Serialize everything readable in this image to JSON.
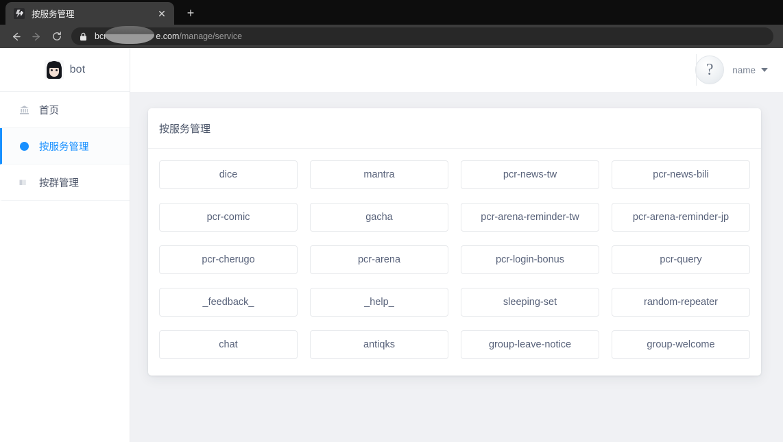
{
  "browser": {
    "tab": {
      "title": "按服务管理",
      "favicon_name": "bot-lightning-favicon",
      "close_label": "✕"
    },
    "new_tab_label": "+",
    "nav": {
      "back_label": "Back",
      "forward_label": "Forward",
      "reload_label": "Reload"
    },
    "omnibox": {
      "lock_label": "Secure",
      "url_prefix": "bcr",
      "url_host_suffix": "e.com",
      "url_path": "/manage/service",
      "redacted": true
    }
  },
  "sidebar": {
    "brand": {
      "name": "bot",
      "avatar_name": "bot-avatar"
    },
    "items": [
      {
        "label": "首页",
        "icon": "bank-icon",
        "active": false
      },
      {
        "label": "按服务管理",
        "icon": "dot-icon",
        "active": true
      },
      {
        "label": "按群管理",
        "icon": "bar-chart-icon",
        "active": false
      }
    ]
  },
  "topbar": {
    "user_name": "name",
    "avatar_glyph": "?",
    "avatar_name": "user-avatar-placeholder",
    "caret_name": "chevron-down-icon"
  },
  "main": {
    "card_title": "按服务管理",
    "services": [
      "dice",
      "mantra",
      "pcr-news-tw",
      "pcr-news-bili",
      "pcr-comic",
      "gacha",
      "pcr-arena-reminder-tw",
      "pcr-arena-reminder-jp",
      "pcr-cherugo",
      "pcr-arena",
      "pcr-login-bonus",
      "pcr-query",
      "_feedback_",
      "_help_",
      "sleeping-set",
      "random-repeater",
      "chat",
      "antiqks",
      "group-leave-notice",
      "group-welcome"
    ]
  },
  "colors": {
    "accent": "#1890ff",
    "page_bg": "#f0f1f4",
    "card_bg": "#ffffff",
    "text": "#58627a",
    "chrome_bg": "#3c3c3c",
    "tabstrip_bg": "#0d0d0d"
  }
}
